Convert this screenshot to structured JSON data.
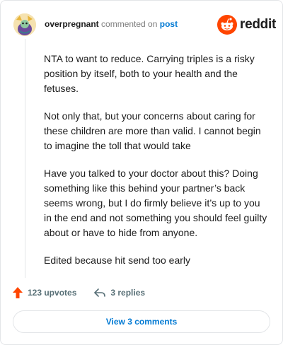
{
  "comment": {
    "username": "overpregnant",
    "action_text": "commented on",
    "post_link": "post",
    "paragraphs": [
      "NTA to want to reduce. Carrying triples is a risky position by itself, both to your health and the fetuses.",
      "Not only that, but your concerns about caring for these children are more than valid. I cannot begin to imagine the toll that would take",
      "Have you talked to your doctor about this? Doing something like this behind your partner’s back seems wrong, but I do firmly believe it’s up to you in the end and not something you should feel guilty about or have to hide from anyone.",
      "Edited because hit send too early"
    ]
  },
  "brand": {
    "wordmark": "reddit",
    "color": "#ff4500"
  },
  "actions": {
    "upvotes": "123 upvotes",
    "replies": "3 replies",
    "upvote_color": "#ff4500"
  },
  "footer": {
    "view_comments": "View 3 comments"
  },
  "icons": {
    "avatar": "avatar",
    "brand": "reddit-logo-icon",
    "upvote": "upvote-arrow-icon",
    "reply": "reply-arrow-icon"
  }
}
